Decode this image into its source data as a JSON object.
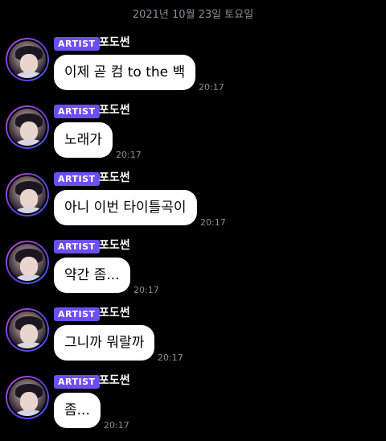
{
  "date_divider": "2021년 10월 23일 토요일",
  "badge_label": "ARTIST",
  "sender_name": "포도썬",
  "messages": [
    {
      "text": "이제 곧 컴 to the 백",
      "time": "20:17"
    },
    {
      "text": "노래가",
      "time": "20:17"
    },
    {
      "text": "아니 이번 타이틀곡이",
      "time": "20:17"
    },
    {
      "text": "약간 좀...",
      "time": "20:17"
    },
    {
      "text": "그니까 뭐랄까",
      "time": "20:17"
    },
    {
      "text": "좀...",
      "time": "20:17"
    }
  ]
}
